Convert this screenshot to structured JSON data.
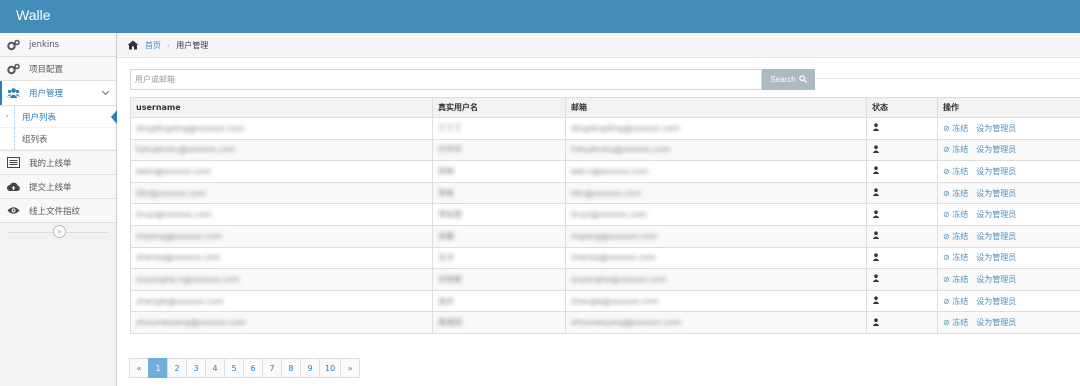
{
  "app": {
    "brand": "Walle"
  },
  "sidebar": {
    "items": [
      {
        "label": "jenkins",
        "icon": "cogs-icon"
      },
      {
        "label": "项目配置",
        "icon": "cogs-icon"
      },
      {
        "label": "用户管理",
        "icon": "users-icon",
        "active": true
      },
      {
        "label": "我的上线单",
        "icon": "list-icon"
      },
      {
        "label": "提交上线单",
        "icon": "cloud-upload-icon"
      },
      {
        "label": "线上文件指纹",
        "icon": "eye-icon"
      }
    ],
    "submenu": [
      {
        "label": "用户列表",
        "active": true
      },
      {
        "label": "组列表"
      }
    ],
    "collapse_glyph": "»"
  },
  "breadcrumb": {
    "home": "首页",
    "sep": "›",
    "current": "用户管理"
  },
  "search": {
    "placeholder": "用户或邮箱",
    "button_label": "Search",
    "button_color": "#abbac3"
  },
  "table": {
    "headers": [
      "username",
      "真实用户名",
      "邮箱",
      "状态",
      "操作"
    ],
    "rows": [
      {
        "username": "dingdingding@xxxxxx.com",
        "realname": "丁丁丁",
        "email": "dingdingding@xxxxxx.com"
      },
      {
        "username": "fuhuahuhu@xxxxxx.com",
        "realname": "付华华",
        "email": "fuhuahuhu@xxxxxx.com"
      },
      {
        "username": "kelin@xxxxxx.com",
        "realname": "柯林",
        "email": "keli.n@xxxxxx.com"
      },
      {
        "username": "lilin@xxxxxx.com",
        "realname": "李林",
        "email": "lilin@xxxxxx.com"
      },
      {
        "username": "liruyi@xxxxxx.com",
        "realname": "李如意",
        "email": "liruyi@xxxxxx.com"
      },
      {
        "username": "mipeng@xxxxxx.com",
        "realname": "米鹏",
        "email": "mipeng@xxxxxx.com"
      },
      {
        "username": "shenka@xxxxxx.com",
        "realname": "沈卡",
        "email": "shenka@xxxxxx.com"
      },
      {
        "username": "xuyanghe.n@xxxxxx.com",
        "realname": "许阳和",
        "email": "xuyanghe@xxxxxx.com"
      },
      {
        "username": "zhangle@xxxxxx.com",
        "realname": "张乐",
        "email": "zhangle@xxxxxx.com"
      },
      {
        "username": "zhoumeiyang@xxxxxx.com",
        "realname": "周美阳",
        "email": "zhoumeiyang@xxxxxx.com"
      }
    ],
    "action_freeze": "冻结",
    "action_admin": "设为管理员"
  },
  "pagination": {
    "prev": "«",
    "next": "»",
    "pages": [
      "1",
      "2",
      "3",
      "4",
      "5",
      "6",
      "7",
      "8",
      "9",
      "10"
    ],
    "current": "1",
    "active_color": "#6faed9"
  }
}
